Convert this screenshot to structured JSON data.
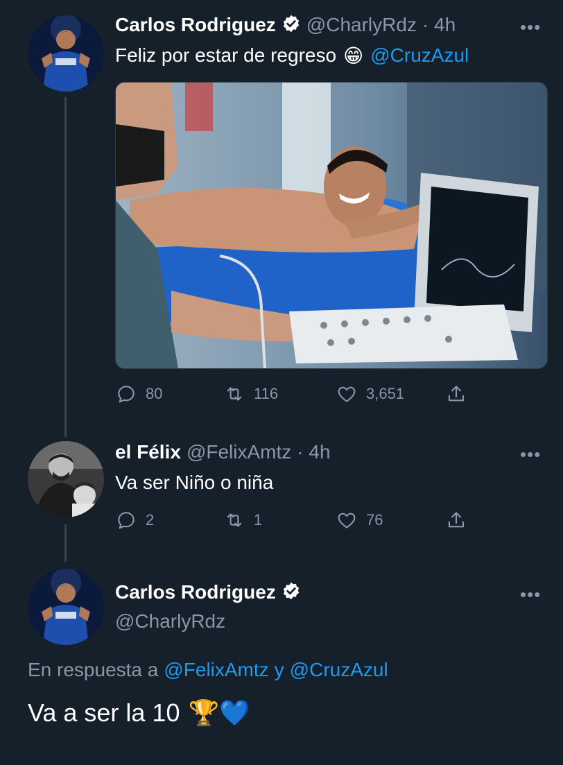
{
  "tweet1": {
    "name": "Carlos Rodriguez",
    "handle": "@CharlyRdz",
    "time": "· 4h",
    "text": "Feliz por estar de regreso",
    "emoji": "😁",
    "mention": "@CruzAzul",
    "stats": {
      "replies": "80",
      "retweets": "116",
      "likes": "3,651"
    }
  },
  "tweet2": {
    "name": "el Félix",
    "handle": "@FelixAmtz",
    "time": "· 4h",
    "text": "Va ser Niño o niña",
    "stats": {
      "replies": "2",
      "retweets": "1",
      "likes": "76"
    }
  },
  "tweet3": {
    "name": "Carlos Rodriguez",
    "handle": "@CharlyRdz",
    "reply_prefix": "En respuesta a",
    "reply_to_1": "@FelixAmtz",
    "reply_and": "y",
    "reply_to_2": "@CruzAzul",
    "text": "Va a ser la 10",
    "emoji": "🏆💙"
  },
  "ui": {
    "more": "•••",
    "accent": "#1d9bf0",
    "background": "#15202b",
    "muted": "#8899a6"
  }
}
